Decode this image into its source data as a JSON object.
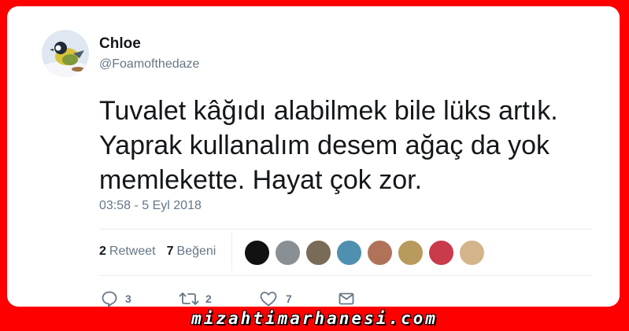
{
  "author": {
    "name": "Chloe",
    "handle": "@Foamofthedaze",
    "avatar_icon": "bird-on-snow-avatar"
  },
  "tweet": {
    "text": "Tuvalet kâğıdı alabilmek bile lüks artık. Yaprak kullanalım desem ağaç da yok memlekette. Hayat çok zor.",
    "timestamp": "03:58 - 5 Eyl 2018"
  },
  "stats": {
    "retweet_count": "2",
    "retweet_label": "Retweet",
    "like_count": "7",
    "like_label": "Beğeni"
  },
  "likers": [
    {
      "icon": "avatar",
      "color": "#111111"
    },
    {
      "icon": "avatar",
      "color": "#8a8f93"
    },
    {
      "icon": "avatar",
      "color": "#7a6a58"
    },
    {
      "icon": "avatar",
      "color": "#4f8fb0"
    },
    {
      "icon": "avatar",
      "color": "#b0735a"
    },
    {
      "icon": "avatar",
      "color": "#b89a5c"
    },
    {
      "icon": "avatar",
      "color": "#c93a4a"
    },
    {
      "icon": "avatar",
      "color": "#d4b48a"
    }
  ],
  "actions": {
    "reply_count": "3",
    "retweet_count": "2",
    "like_count": "7"
  },
  "footer": {
    "watermark": "mizahtimarhanesi.com"
  }
}
